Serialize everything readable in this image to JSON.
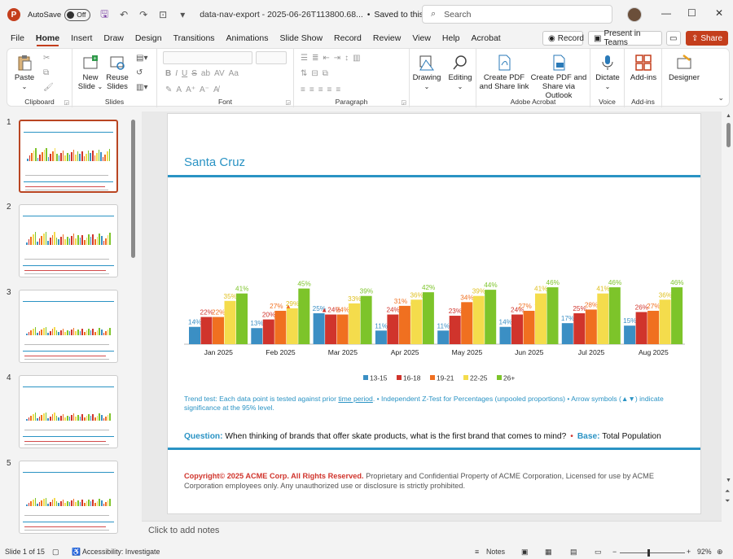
{
  "titlebar": {
    "autosave_label": "AutoSave",
    "autosave_state": "Off",
    "doc_title": "data-nav-export - 2025-06-26T113800.68...",
    "save_status": "Saved to this PC",
    "search_placeholder": "Search"
  },
  "tabs": [
    "File",
    "Home",
    "Insert",
    "Draw",
    "Design",
    "Transitions",
    "Animations",
    "Slide Show",
    "Record",
    "Review",
    "View",
    "Help",
    "Acrobat"
  ],
  "tab_actions": {
    "record": "Record",
    "present": "Present in Teams",
    "share": "Share"
  },
  "ribbon": {
    "clipboard": {
      "paste": "Paste",
      "label": "Clipboard"
    },
    "slides": {
      "new_slide_1": "New",
      "new_slide_2": "Slide",
      "reuse_1": "Reuse",
      "reuse_2": "Slides",
      "label": "Slides"
    },
    "font": {
      "label": "Font"
    },
    "paragraph": {
      "label": "Paragraph"
    },
    "drawing": "Drawing",
    "editing": "Editing",
    "acrobat": {
      "create_pdf_1": "Create PDF",
      "create_pdf_2": "and Share link",
      "share_outlook_1": "Create PDF and",
      "share_outlook_2": "Share via Outlook",
      "label": "Adobe Acrobat"
    },
    "voice": {
      "dictate": "Dictate",
      "label": "Voice"
    },
    "addins": {
      "addins": "Add-ins",
      "label": "Add-ins"
    },
    "designer": "Designer"
  },
  "thumbnails": [
    "1",
    "2",
    "3",
    "4",
    "5"
  ],
  "slide": {
    "title": "Santa Cruz",
    "trend_part1": "Trend test: Each data point is tested against prior ",
    "trend_underlined": "time period",
    "trend_part2": ". • Independent Z-Test for Percentages (unpooled proportions) • Arrow symbols (▲▼) indicate significance at the 95% level.",
    "question_label": "Question:",
    "question_text": "When thinking of brands that offer skate products, what is the first brand that comes to mind?",
    "base_label": "Base:",
    "base_text": "Total Population",
    "copyright_bold": "Copyright© 2025 ACME Corp. All Rights Reserved.",
    "copyright_text": " Proprietary and Confidential Property of ACME Corporation, Licensed for use by ACME Corporation employees only. Any unauthorized use or disclosure is strictly prohibited."
  },
  "chart_data": {
    "type": "bar",
    "categories": [
      "Jan 2025",
      "Feb 2025",
      "Mar 2025",
      "Apr 2025",
      "May 2025",
      "Jun 2025",
      "Jul 2025",
      "Aug 2025"
    ],
    "series": [
      {
        "name": "13-15",
        "color": "#3b8fc4",
        "values": [
          14,
          13,
          25,
          11,
          11,
          14,
          17,
          15
        ]
      },
      {
        "name": "16-18",
        "color": "#d0342c",
        "values": [
          22,
          20,
          24,
          24,
          23,
          24,
          25,
          26
        ]
      },
      {
        "name": "19-21",
        "color": "#f07020",
        "values": [
          22,
          27,
          24,
          31,
          34,
          27,
          28,
          27
        ]
      },
      {
        "name": "22-25",
        "color": "#f4dc4c",
        "values": [
          35,
          29,
          33,
          36,
          39,
          41,
          41,
          36
        ]
      },
      {
        "name": "26+",
        "color": "#7dc42a",
        "values": [
          41,
          45,
          39,
          42,
          44,
          46,
          46,
          46
        ]
      }
    ],
    "labels": [
      [
        "14%",
        "22%",
        "22%",
        "35%",
        "41%"
      ],
      [
        "13%",
        "20%",
        "27% ▲",
        "29%",
        "45%"
      ],
      [
        "25%",
        "▲24%",
        "24%",
        "33%",
        "39%"
      ],
      [
        "11%",
        "24%",
        "31% ▲",
        "36%",
        "42%"
      ],
      [
        "11%",
        "23%",
        "34%",
        "39%",
        "44%"
      ],
      [
        "14%",
        "24%",
        "27% ▼",
        "41%",
        "46%"
      ],
      [
        "17%",
        "25%",
        "28%",
        "41%",
        "46%"
      ],
      [
        "15%",
        "26%",
        "27%",
        "36%",
        "46%"
      ]
    ],
    "ylim": [
      0,
      50
    ],
    "legend_position": "bottom"
  },
  "notes_placeholder": "Click to add notes",
  "status": {
    "slide_of": "Slide 1 of 15",
    "accessibility": "Accessibility: Investigate",
    "notes": "Notes",
    "zoom": "92%"
  }
}
